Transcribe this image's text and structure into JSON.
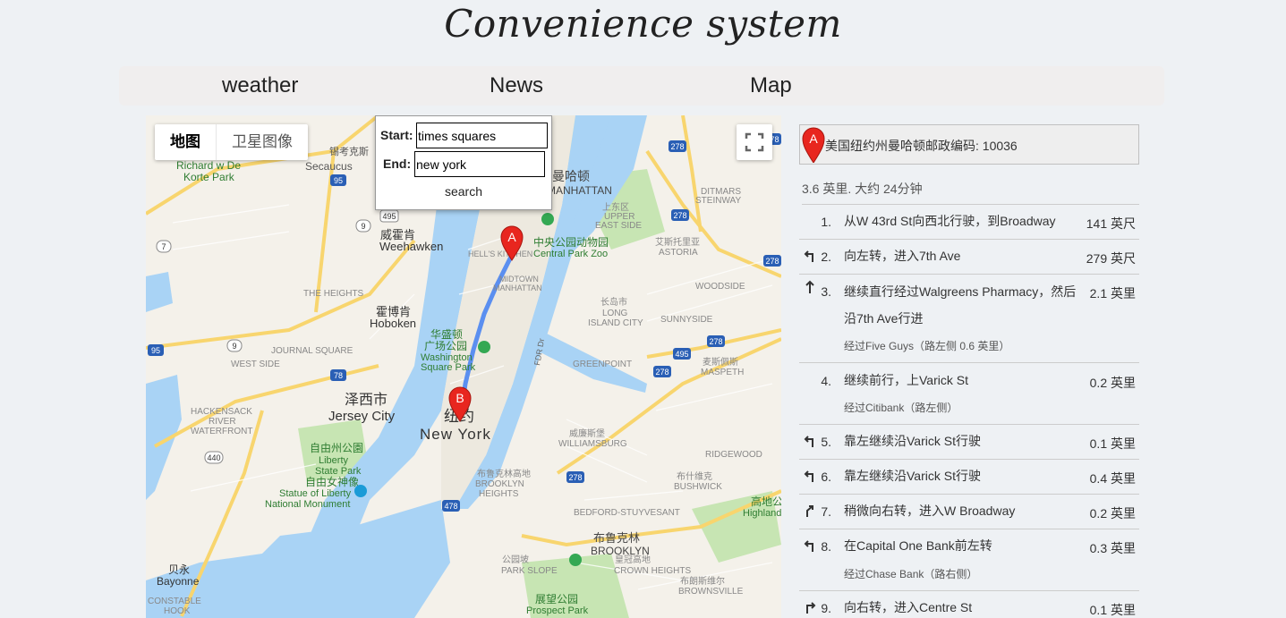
{
  "app": {
    "title": "Convenience system"
  },
  "nav": {
    "items": [
      "weather",
      "News",
      "Map"
    ]
  },
  "map": {
    "map_type": {
      "map_label": "地图",
      "satellite_label": "卫星图像",
      "selected": "地图"
    },
    "route_form": {
      "start_label": "Start:",
      "start_value": "times squares",
      "end_label": "End:",
      "end_value": "new york",
      "search_label": "search"
    },
    "markers": {
      "a": "A",
      "b": "B"
    },
    "labels": {
      "secaucus_cn": "锡考克斯",
      "secaucus": "Secaucus",
      "richard_park": "Richard w De",
      "richard_park2": "Korte Park",
      "weehawken_cn": "威霍肯",
      "weehawken": "Weehawken",
      "heights": "THE HEIGHTS",
      "hoboken_cn": "霍博肯",
      "hoboken": "Hoboken",
      "journal_sq": "JOURNAL SQUARE",
      "west_side": "WEST SIDE",
      "jersey_cn": "泽西市",
      "jersey": "Jersey City",
      "hackensack": "HACKENSACK",
      "river": "RIVER",
      "waterfront": "WATERFRONT",
      "liberty_park_cn": "自由州公園",
      "liberty_park": "Liberty",
      "liberty_park2": "State Park",
      "liberty_statue_cn": "自由女神像",
      "liberty_statue": "Statue of Liberty",
      "liberty_statue2": "National Monument",
      "bayonne_cn": "贝永",
      "bayonne": "Bayonne",
      "constable": "CONSTABLE",
      "hook": "HOOK",
      "newyork_cn": "纽约",
      "newyork": "New York",
      "wash_cn": "华盛顿",
      "wash_cn2": "广场公园",
      "wash": "Washington",
      "wash2": "Square Park",
      "zoo_cn": "中央公园动物园",
      "zoo": "Central Park Zoo",
      "hells_kitchen": "HELL'S KITCHEN",
      "midtown": "MIDTOWN",
      "manhattan_mid": "MANHATTAN",
      "manhattan_cn": "曼哈顿",
      "manhattan": "MANHATTAN",
      "upper_cn": "上东区",
      "upper_east": "UPPER",
      "upper_east2": "EAST SIDE",
      "astoria_cn": "艾斯托里亚",
      "astoria": "ASTORIA",
      "ditmars": "DITMARS",
      "steinway": "STEINWAY",
      "woodside": "WOODSIDE",
      "lic_cn": "长岛市",
      "lic": "LONG",
      "lic2": "ISLAND CITY",
      "sunnyside": "SUNNYSIDE",
      "greenpoint": "GREENPOINT",
      "maspeth_cn": "麦斯佩斯",
      "maspeth": "MASPETH",
      "williamsburg_cn": "威廉斯堡",
      "williamsburg": "WILLIAMSBURG",
      "ridgewood": "RIDGEWOOD",
      "bk_heights_cn": "布鲁克林高地",
      "bk_heights": "BROOKLYN",
      "bk_heights2": "HEIGHTS",
      "bushwick_cn": "布什维克",
      "bushwick": "BUSHWICK",
      "highland_cn": "高地公",
      "highland": "Highland",
      "bedford": "BEDFORD-STUYVESANT",
      "brooklyn_cn": "布鲁克林",
      "brooklyn": "BROOKLYN",
      "park_slope_cn": "公园坡",
      "park_slope": "PARK SLOPE",
      "crown_cn": "皇冠高地",
      "crown": "CROWN HEIGHTS",
      "prospect_cn": "展望公园",
      "prospect": "Prospect Park",
      "brownsville_cn": "布朗斯维尔",
      "brownsville": "BROWNSVILLE",
      "fdr": "FDR Dr",
      "roads": [
        "95",
        "495",
        "9",
        "7",
        "9",
        "95",
        "78",
        "440",
        "478",
        "278",
        "278",
        "278",
        "278",
        "495",
        "278",
        "278",
        "278"
      ]
    }
  },
  "directions": {
    "destination": "美国纽约州曼哈顿邮政编码: 10036",
    "summary": "3.6 英里. 大约 24分钟",
    "steps": [
      {
        "num": "1.",
        "icon": "none",
        "line1": "从W 43rd St向西北行驶，到Broadway",
        "dist": "141 英尺",
        "note": ""
      },
      {
        "num": "2.",
        "icon": "turn-left-icon",
        "line1": "向左转，进入7th Ave",
        "dist": "279 英尺",
        "note": ""
      },
      {
        "num": "3.",
        "icon": "straight-icon",
        "line1": "继续直行经过Walgreens Pharmacy，然后",
        "line2": "沿7th Ave行进",
        "dist": "2.1 英里",
        "note": "经过Five Guys（路左侧 0.6 英里）"
      },
      {
        "num": "4.",
        "icon": "none",
        "line1": "继续前行，上Varick St",
        "dist": "0.2 英里",
        "note": "经过Citibank（路左侧）"
      },
      {
        "num": "5.",
        "icon": "keep-left-icon",
        "line1": "靠左继续沿Varick St行驶",
        "dist": "0.1 英里",
        "note": ""
      },
      {
        "num": "6.",
        "icon": "keep-left-icon",
        "line1": "靠左继续沿Varick St行驶",
        "dist": "0.4 英里",
        "note": ""
      },
      {
        "num": "7.",
        "icon": "slight-right-icon",
        "line1": "稍微向右转，进入W Broadway",
        "dist": "0.2 英里",
        "note": ""
      },
      {
        "num": "8.",
        "icon": "keep-left-icon",
        "line1": "在Capital One Bank前左转",
        "dist": "0.3 英里",
        "note": "经过Chase Bank（路右侧）"
      },
      {
        "num": "9.",
        "icon": "turn-right-icon",
        "line1": "向右转，进入Centre St",
        "dist": "0.1 英里",
        "note": ""
      }
    ]
  },
  "colors": {
    "water": "#a9d3f5",
    "land": "#f4f1ea",
    "park": "#c7e5b3",
    "route": "#5b8ff0",
    "marker": "#e8261f",
    "highway": "#f8d56e"
  }
}
